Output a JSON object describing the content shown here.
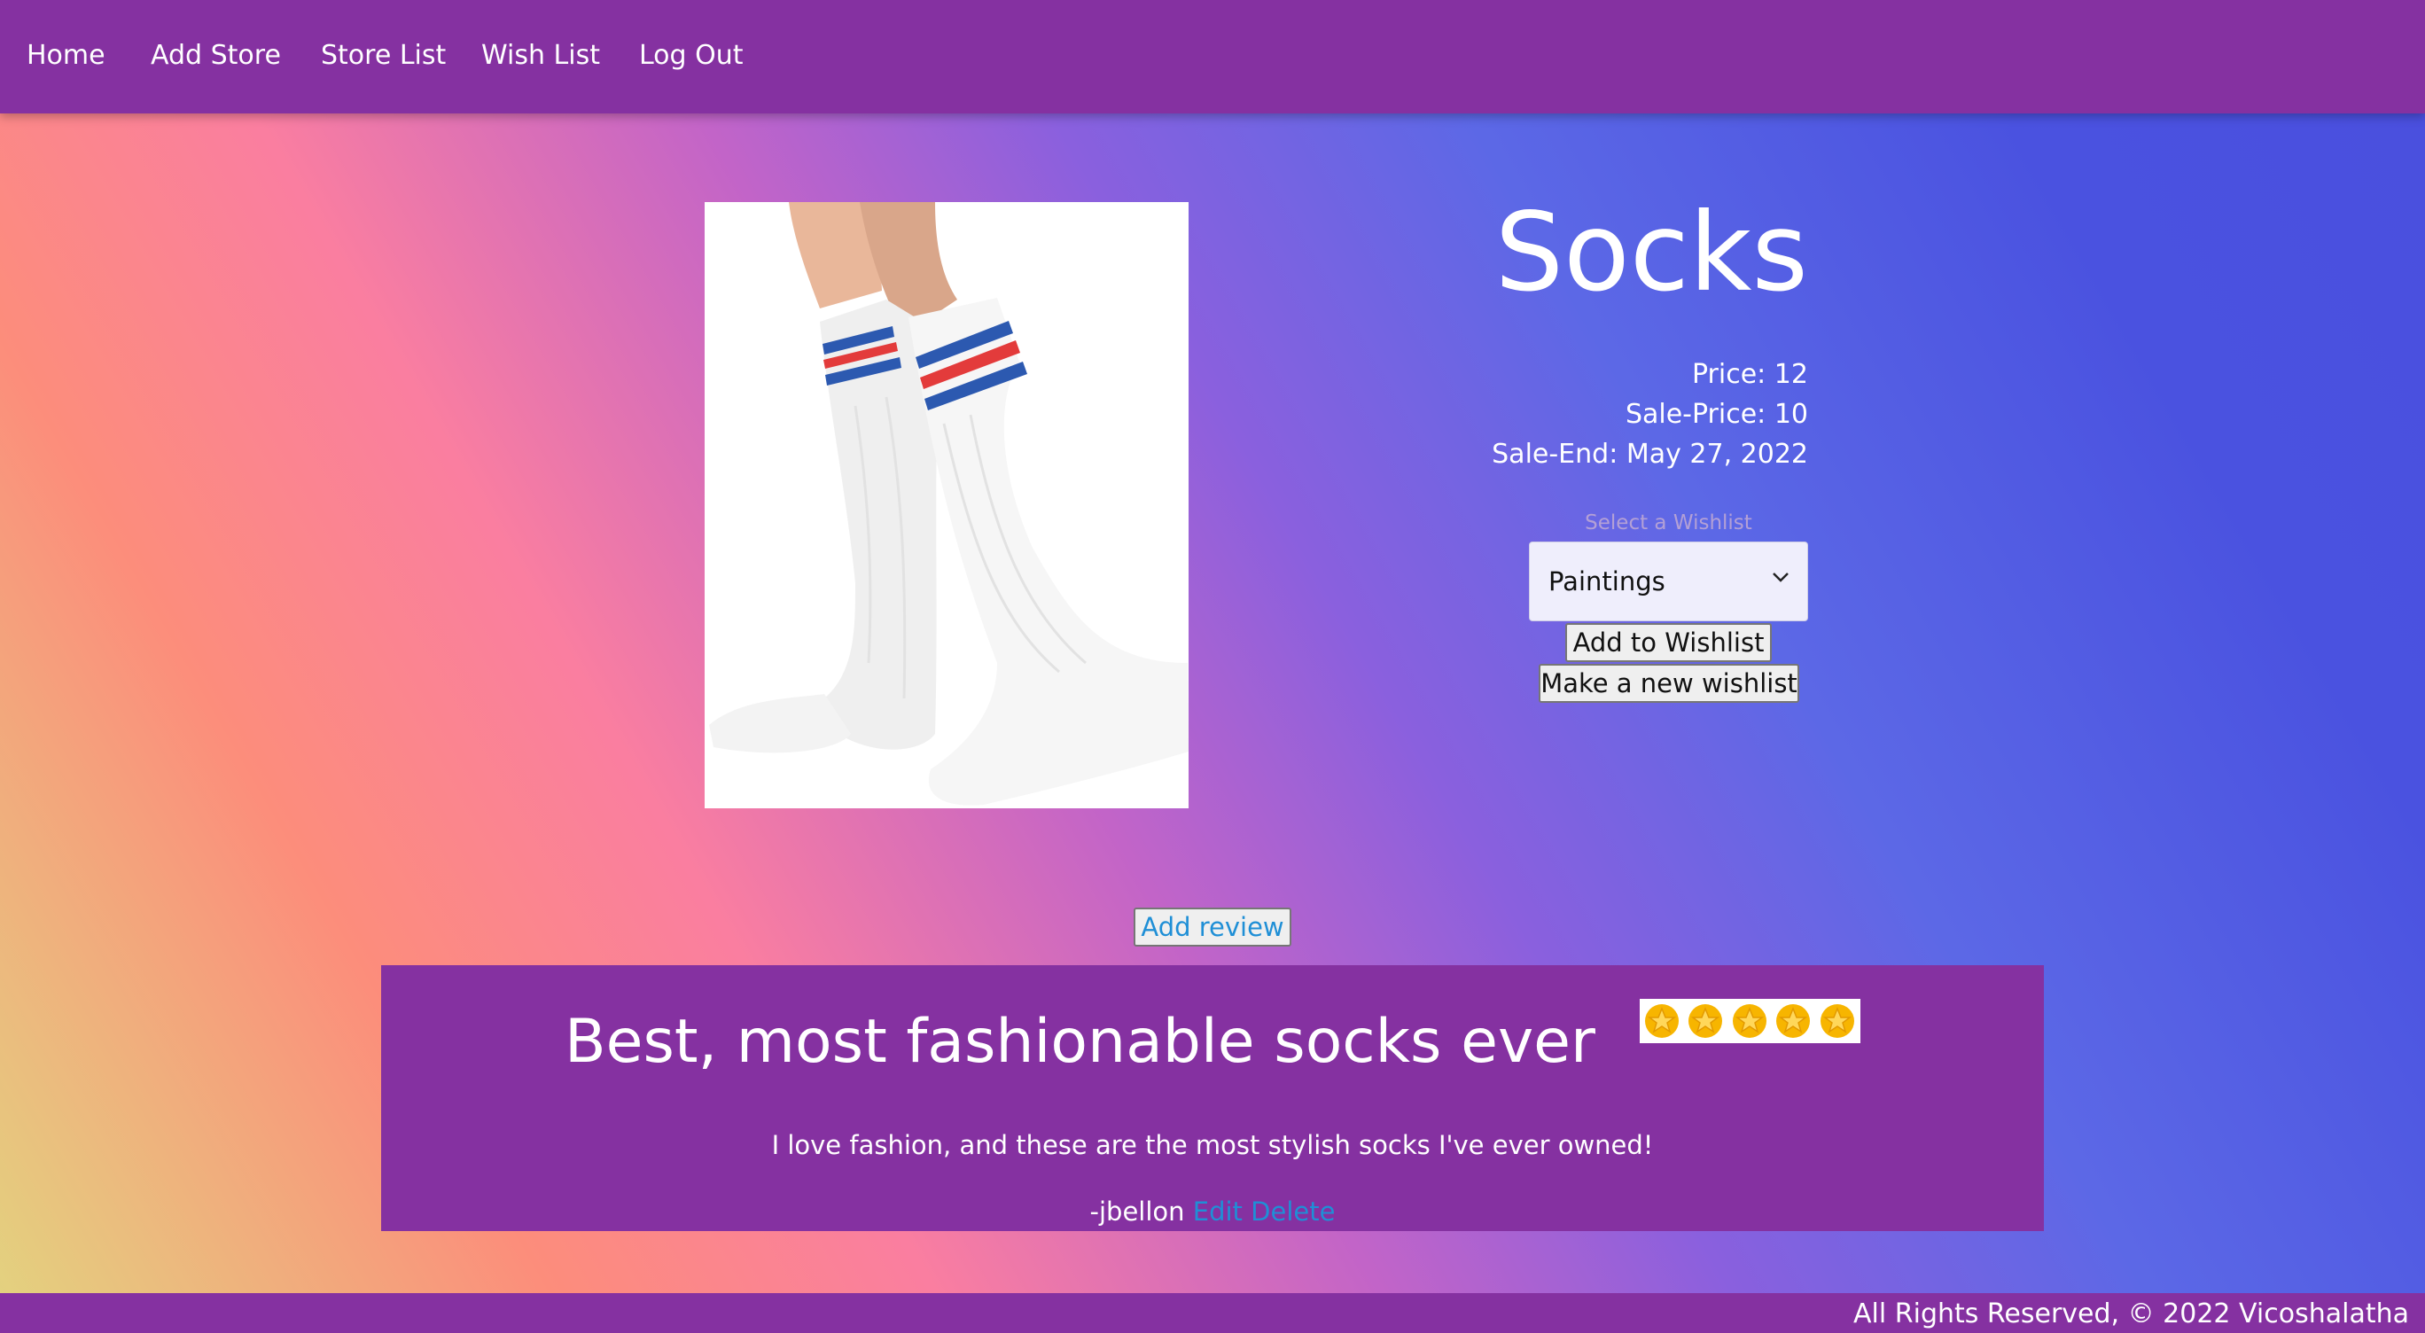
{
  "nav": {
    "home": "Home",
    "add_store": "Add Store",
    "store_list": "Store List",
    "wish_list": "Wish List",
    "log_out": "Log Out"
  },
  "product": {
    "title": "Socks",
    "price": "Price: 12",
    "sale_price": "Sale-Price: 10",
    "sale_end": "Sale-End: May 27, 2022",
    "image_icon": "knee-high-tube-socks"
  },
  "wishlist": {
    "label": "Select a Wishlist",
    "selected": "Paintings",
    "add_button": "Add to Wishlist",
    "new_button": "Make a new wishlist"
  },
  "reviews": {
    "add_button": "Add review",
    "items": [
      {
        "title": "Best, most fashionable socks ever",
        "rating": 5,
        "body": "I love fashion, and these are the most stylish socks I've ever owned!",
        "author": "-jbellon",
        "edit": "Edit",
        "delete": "Delete"
      }
    ]
  },
  "footer": {
    "text": "All Rights Reserved, © 2022 Vicoshalatha"
  },
  "colors": {
    "nav_bg": "#8531a1",
    "link": "#1f8fd6",
    "star": "#f7b500"
  }
}
